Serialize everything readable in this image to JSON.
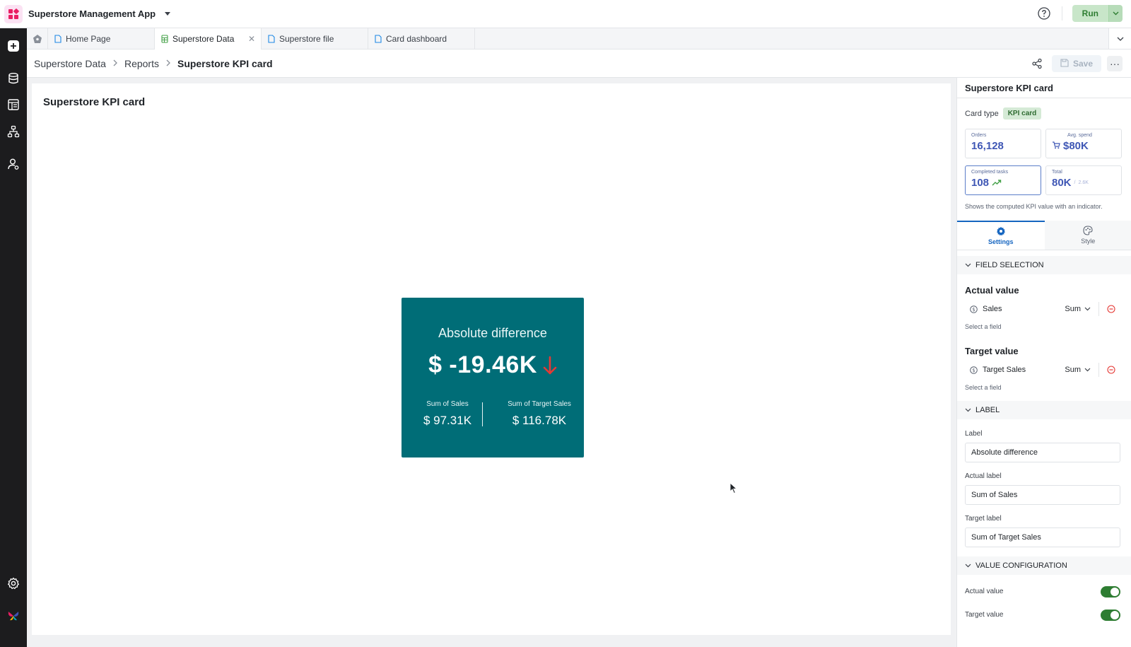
{
  "app": {
    "title": "Superstore Management App",
    "run_label": "Run",
    "accent_color": "#2e7d32",
    "logo_color": "#e91e63"
  },
  "sidebar": {
    "items": [
      {
        "name": "add-icon"
      },
      {
        "name": "database-icon"
      },
      {
        "name": "table-icon"
      },
      {
        "name": "workflow-icon"
      },
      {
        "name": "user-settings-icon"
      },
      {
        "name": "gear-icon"
      },
      {
        "name": "butterfly-logo-icon"
      }
    ]
  },
  "tabs": [
    {
      "label": "Home Page",
      "icon": "document-icon",
      "active": false
    },
    {
      "label": "Superstore Data",
      "icon": "sheet-icon",
      "active": true
    },
    {
      "label": "Superstore file",
      "icon": "document-icon",
      "active": false
    },
    {
      "label": "Card dashboard",
      "icon": "document-icon",
      "active": false
    }
  ],
  "breadcrumb": {
    "items": [
      "Superstore Data",
      "Reports",
      "Superstore KPI card"
    ],
    "separator": ">",
    "save_label": "Save",
    "more_label": "···"
  },
  "canvas": {
    "title": "Superstore KPI card",
    "kpi": {
      "label": "Absolute difference",
      "value": "$ -19.46K",
      "trend": "down",
      "trend_color": "#e53935",
      "background": "#006d77",
      "actual_label": "Sum of Sales",
      "actual_value": "$ 97.31K",
      "target_label": "Sum of Target Sales",
      "target_value": "$ 116.78K"
    }
  },
  "panel": {
    "title": "Superstore KPI card",
    "card_type_label": "Card type",
    "card_type_value": "KPI card",
    "previews": [
      {
        "label": "Orders",
        "value": "16,128"
      },
      {
        "label": "Avg. spend",
        "value": "$80K"
      },
      {
        "label": "Completed tasks",
        "value": "108"
      },
      {
        "label": "Total",
        "value": "80K",
        "secondary": "2.6K"
      }
    ],
    "description": "Shows the computed KPI value with an indicator.",
    "tabs": [
      {
        "label": "Settings",
        "active": true
      },
      {
        "label": "Style",
        "active": false
      }
    ],
    "sections": {
      "field_selection": "FIELD SELECTION",
      "label": "LABEL",
      "value_configuration": "VALUE CONFIGURATION"
    },
    "actual": {
      "title": "Actual value",
      "field": "Sales",
      "aggregation": "Sum",
      "hint": "Select a field"
    },
    "target": {
      "title": "Target value",
      "field": "Target Sales",
      "aggregation": "Sum",
      "hint": "Select a field"
    },
    "label_inputs": {
      "label_title": "Label",
      "label_value": "Absolute difference",
      "actual_title": "Actual label",
      "actual_value": "Sum of Sales",
      "target_title": "Target label",
      "target_value": "Sum of Target Sales"
    },
    "value_config": {
      "actual_label": "Actual value",
      "actual_on": true,
      "target_label": "Target value",
      "target_on": true
    }
  }
}
